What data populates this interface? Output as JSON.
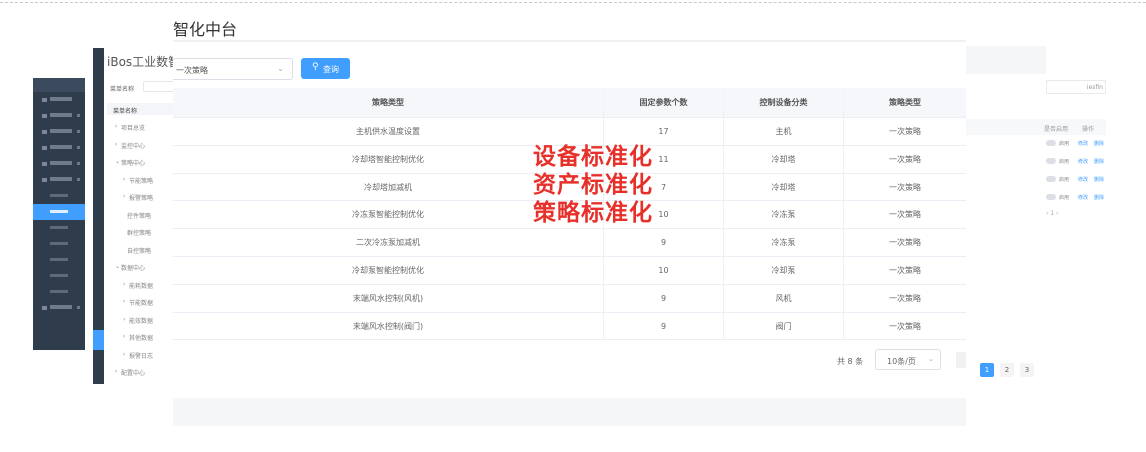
{
  "main": {
    "title": "智化中台",
    "filter": {
      "value": "一次策略",
      "arrow": "⌄"
    },
    "query_button": {
      "icon": "search-icon",
      "label": "查询"
    },
    "table": {
      "columns": [
        "策略类型",
        "固定参数个数",
        "控制设备分类",
        "策略类型"
      ],
      "rows": [
        [
          "主机供水温度设置",
          "17",
          "主机",
          "一次策略"
        ],
        [
          "冷却塔智能控制优化",
          "11",
          "冷却塔",
          "一次策略"
        ],
        [
          "冷却塔加减机",
          "7",
          "冷却塔",
          "一次策略"
        ],
        [
          "冷冻泵智能控制优化",
          "10",
          "冷冻泵",
          "一次策略"
        ],
        [
          "二次冷冻泵加减机",
          "9",
          "冷冻泵",
          "一次策略"
        ],
        [
          "冷却泵智能控制优化",
          "10",
          "冷却泵",
          "一次策略"
        ],
        [
          "末端风水控制(风机)",
          "9",
          "风机",
          "一次策略"
        ],
        [
          "末端风水控制(阀门)",
          "9",
          "阀门",
          "一次策略"
        ]
      ]
    },
    "footer": {
      "total": "共 8 条",
      "page_size": "10条/页",
      "page_size_arrow": "⌄"
    }
  },
  "pagination": {
    "pages": [
      "1",
      "2",
      "3"
    ],
    "current": "1"
  },
  "overlay_lines": [
    "设备标准化",
    "资产标准化",
    "策略标准化"
  ],
  "mid_window": {
    "brand": "iBos工业数智化",
    "menu_name_label": "菜单名称",
    "tree_header": "菜单名称",
    "tree": [
      {
        "label": "项目总览",
        "indent": 1,
        "prefix": "›"
      },
      {
        "label": "监控中心",
        "indent": 1,
        "prefix": "›"
      },
      {
        "label": "策略中心",
        "indent": 1,
        "prefix": "⌄"
      },
      {
        "label": "节能策略",
        "indent": 2,
        "prefix": "›"
      },
      {
        "label": "报警策略",
        "indent": 2,
        "prefix": "›"
      },
      {
        "label": "控件策略",
        "indent": 3,
        "prefix": ""
      },
      {
        "label": "群控策略",
        "indent": 3,
        "prefix": ""
      },
      {
        "label": "自控策略",
        "indent": 3,
        "prefix": ""
      },
      {
        "label": "数据中心",
        "indent": 1,
        "prefix": "⌄"
      },
      {
        "label": "能耗数据",
        "indent": 2,
        "prefix": "›"
      },
      {
        "label": "节能数据",
        "indent": 2,
        "prefix": "›"
      },
      {
        "label": "能效数据",
        "indent": 2,
        "prefix": "›"
      },
      {
        "label": "其他数据",
        "indent": 2,
        "prefix": "›"
      },
      {
        "label": "报警日志",
        "indent": 2,
        "prefix": "›"
      },
      {
        "label": "配置中心",
        "indent": 1,
        "prefix": "›"
      }
    ]
  },
  "right_window": {
    "search_hint": "iesfin",
    "col_a": "是否启用",
    "col_b": "操作",
    "row_status": "启用",
    "row_edit": "修改",
    "row_delete": "删除",
    "pager": "‹  1  ›"
  },
  "colors": {
    "primary": "#409eff",
    "overlay": "#e8302a",
    "sidebar": "#2f3c4c"
  }
}
